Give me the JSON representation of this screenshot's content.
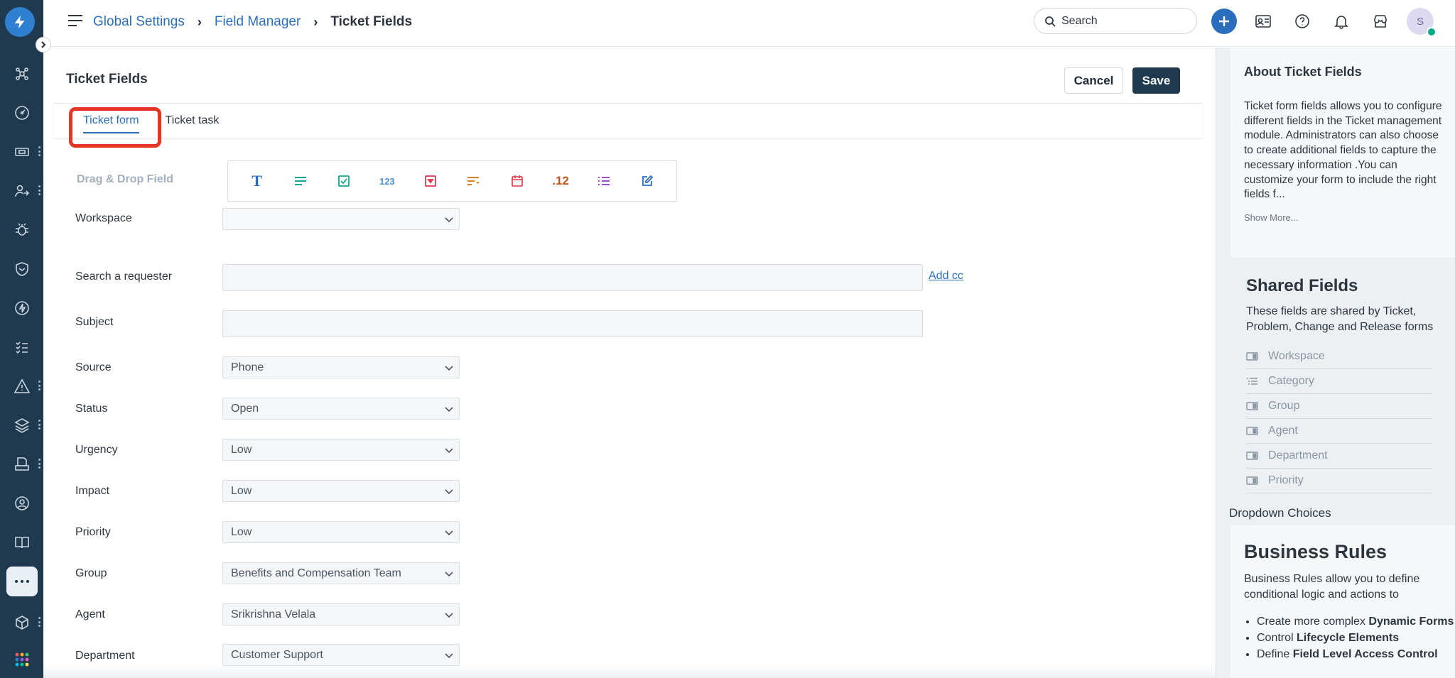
{
  "breadcrumb": {
    "item1": "Global Settings",
    "item2": "Field Manager",
    "current": "Ticket Fields"
  },
  "search": {
    "placeholder": "Search"
  },
  "user": {
    "initial": "S"
  },
  "page": {
    "title": "Ticket Fields",
    "cancel_label": "Cancel",
    "save_label": "Save"
  },
  "tabs": [
    {
      "label": "Ticket form",
      "active": true
    },
    {
      "label": "Ticket task",
      "active": false
    }
  ],
  "palette": {
    "label": "Drag & Drop Field",
    "number_text": "123",
    "decimal_text": ".12"
  },
  "form": {
    "workspace": {
      "label": "Workspace",
      "value": ""
    },
    "requester": {
      "label": "Search a requester",
      "value": "",
      "add_cc": "Add cc"
    },
    "subject": {
      "label": "Subject",
      "value": ""
    },
    "source": {
      "label": "Source",
      "value": "Phone"
    },
    "status": {
      "label": "Status",
      "value": "Open"
    },
    "urgency": {
      "label": "Urgency",
      "value": "Low"
    },
    "impact": {
      "label": "Impact",
      "value": "Low"
    },
    "priority": {
      "label": "Priority",
      "value": "Low"
    },
    "group": {
      "label": "Group",
      "value": "Benefits and Compensation Team"
    },
    "agent": {
      "label": "Agent",
      "value": "Srikrishna Velala"
    },
    "department": {
      "label": "Department",
      "value": "Customer Support"
    }
  },
  "about": {
    "title": "About Ticket Fields",
    "body": "Ticket form fields allows you to configure different fields in the Ticket management module. Administrators can also choose to create additional fields to capture the necessary information .You can customize your form to include the right fields f...",
    "more": "Show More..."
  },
  "shared": {
    "title": "Shared Fields",
    "subtitle": "These fields are shared by Ticket, Problem, Change and Release forms",
    "items": [
      "Workspace",
      "Category",
      "Group",
      "Agent",
      "Department",
      "Priority"
    ]
  },
  "dropdown_choices": "Dropdown Choices",
  "rules": {
    "title": "Business Rules",
    "body": "Business Rules allow you to define conditional logic and actions to",
    "bullets": [
      {
        "pre": "Create more complex ",
        "bold": "Dynamic Forms"
      },
      {
        "pre": "Control ",
        "bold": "Lifecycle Elements"
      },
      {
        "pre": "Define ",
        "bold": "Field Level Access Control"
      }
    ]
  },
  "colors": {
    "brand": "#2a6ebd",
    "nav_bg": "#1f3a4e",
    "highlight": "#e53623",
    "save_bg": "#1f3a4e"
  },
  "icons": {
    "nav": [
      "bolt-logo-icon",
      "bug-cluster-icon",
      "dashboard-icon",
      "ticket-icon",
      "user-swap-icon",
      "bug-icon",
      "shield-icon",
      "lightning-icon",
      "checklist-icon",
      "alert-icon",
      "layers-icon",
      "printer-icon",
      "support-icon",
      "book-icon",
      "more-icon",
      "cube-icon",
      "apps-grid-icon"
    ]
  }
}
